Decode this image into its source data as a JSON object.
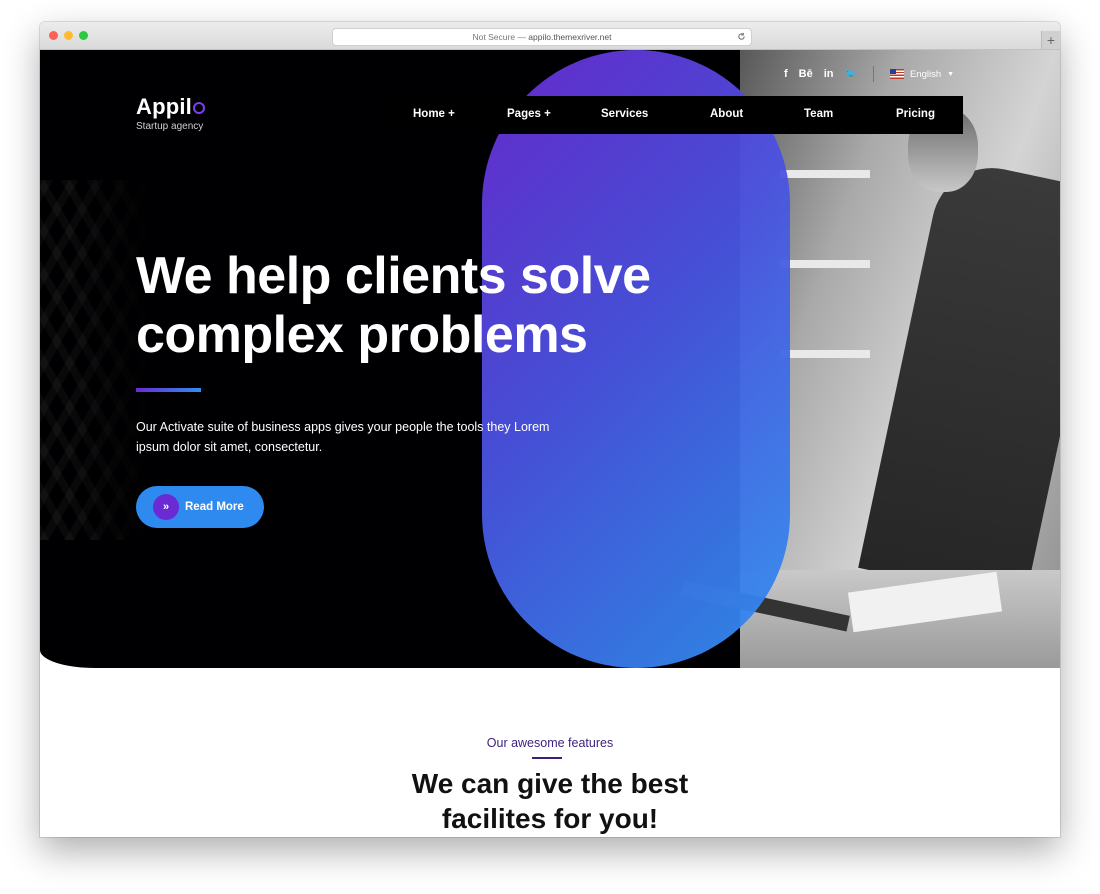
{
  "browser": {
    "address_prefix": "Not Secure —",
    "address_url": "appilo.themexriver.net",
    "newtab_label": "+"
  },
  "brand": {
    "name": "Appil",
    "tagline": "Startup agency",
    "accent_color": "#7b3ff2"
  },
  "topbar": {
    "social": [
      "f",
      "Bē",
      "in",
      "🐦"
    ],
    "language": "English"
  },
  "nav": {
    "items": [
      "Home +",
      "Pages +",
      "Services",
      "About",
      "Team",
      "Pricing"
    ]
  },
  "hero": {
    "title_line1": "We help clients solve",
    "title_line2": "complex problems",
    "description": "Our Activate suite of business apps gives your people the tools they Lorem ipsum dolor sit amet, consectetur.",
    "cta_icon": "»",
    "cta_label": "Read More",
    "gradient_start": "#6a2bd5",
    "gradient_end": "#2f8ff0"
  },
  "features": {
    "eyebrow": "Our awesome features",
    "title_line1": "We can give the best",
    "title_line2": "facilites for you!"
  }
}
